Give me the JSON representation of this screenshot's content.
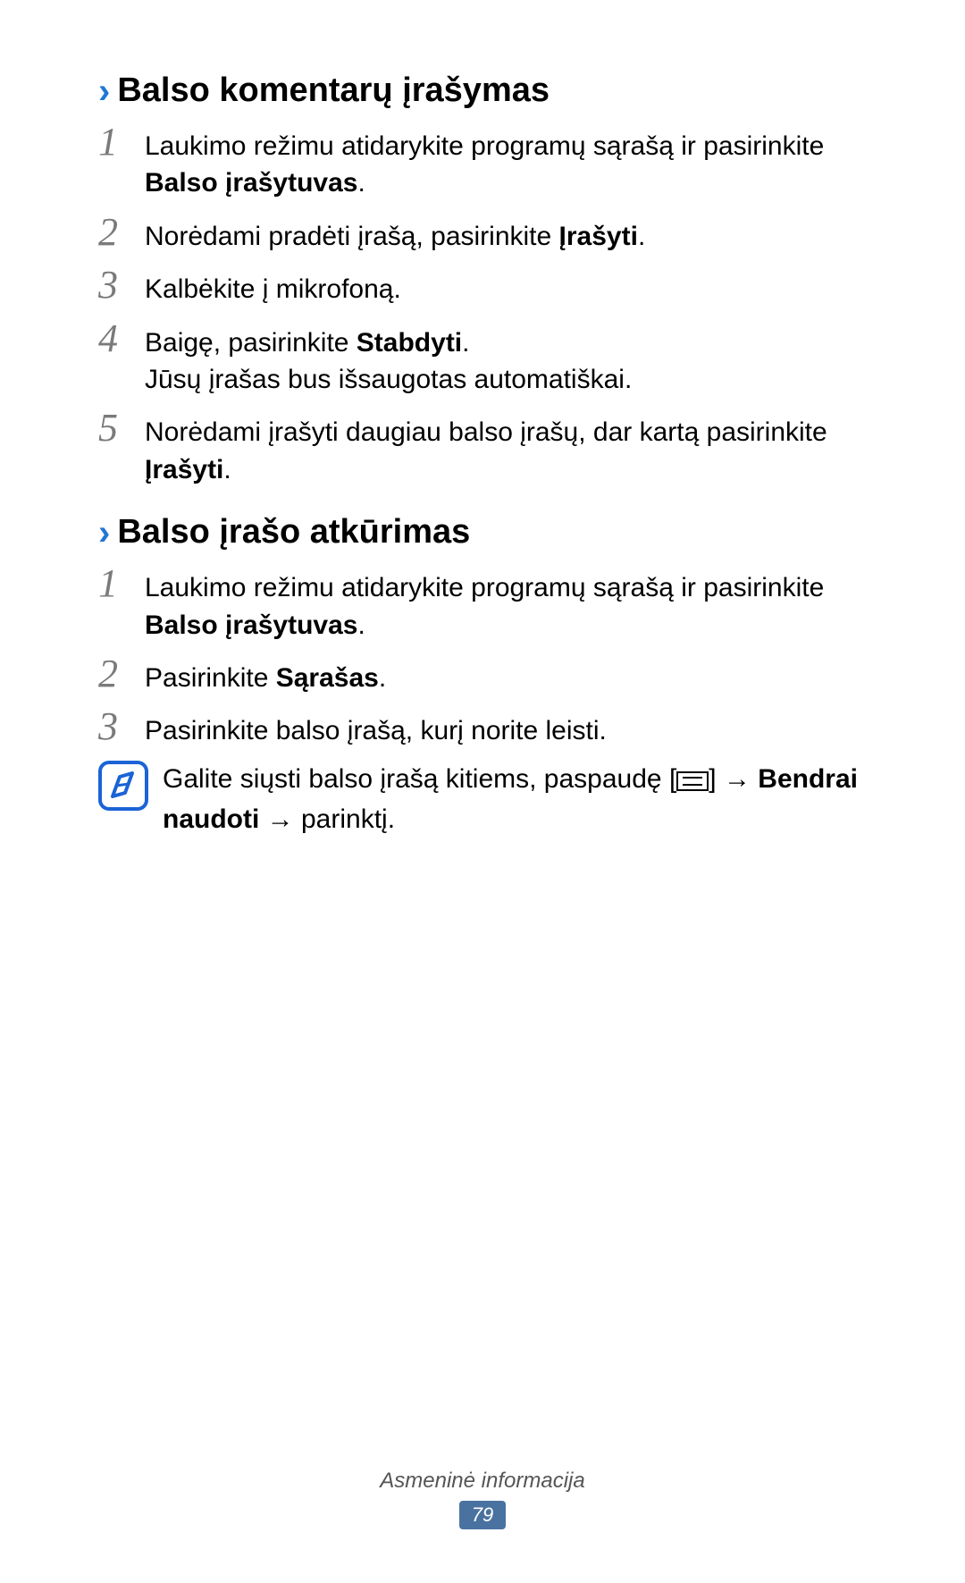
{
  "sections": [
    {
      "heading": "Balso komentarų įrašymas",
      "steps": [
        {
          "num": "1",
          "pre": "Laukimo režimu atidarykite programų sąrašą ir pasirinkite ",
          "bold": "Balso įrašytuvas",
          "post": "."
        },
        {
          "num": "2",
          "pre": "Norėdami pradėti įrašą, pasirinkite ",
          "bold": "Įrašyti",
          "post": "."
        },
        {
          "num": "3",
          "pre": "Kalbėkite į mikrofoną.",
          "bold": "",
          "post": ""
        },
        {
          "num": "4",
          "pre": "Baigę, pasirinkite ",
          "bold": "Stabdyti",
          "post": ".",
          "line2": "Jūsų įrašas bus išsaugotas automatiškai."
        },
        {
          "num": "5",
          "pre": "Norėdami įrašyti daugiau balso įrašų, dar kartą pasirinkite ",
          "bold": "Įrašyti",
          "post": "."
        }
      ]
    },
    {
      "heading": "Balso įrašo atkūrimas",
      "steps": [
        {
          "num": "1",
          "pre": "Laukimo režimu atidarykite programų sąrašą ir pasirinkite ",
          "bold": "Balso įrašytuvas",
          "post": "."
        },
        {
          "num": "2",
          "pre": "Pasirinkite ",
          "bold": "Sąrašas",
          "post": "."
        },
        {
          "num": "3",
          "pre": "Pasirinkite balso įrašą, kurį norite leisti.",
          "bold": "",
          "post": ""
        }
      ],
      "note": {
        "pre": "Galite siųsti balso įrašą kitiems, paspaudę [",
        "mid": "] → ",
        "bold": "Bendrai naudoti",
        "post": " → parinktį."
      }
    }
  ],
  "footer": {
    "title": "Asmeninė informacija",
    "page": "79"
  }
}
